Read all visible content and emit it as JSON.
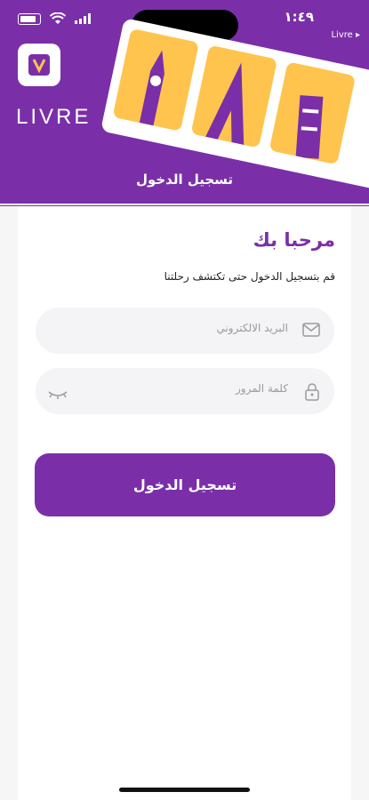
{
  "status_bar": {
    "time": "١:٤٩",
    "back_app": "Livre ▸"
  },
  "brand": {
    "name": "LIVRE"
  },
  "header": {
    "title": "تسجيل الدخول"
  },
  "form": {
    "welcome": "مرحبا بك",
    "subtitle": "قم بتسجيل الدخول حتى تكتشف رحلتنا",
    "email_placeholder": "البريد الالكتروني",
    "password_placeholder": "كلمة المرور",
    "submit_label": "تسجيل الدخول"
  },
  "colors": {
    "primary": "#7a2fa8",
    "accent": "#ffc44d",
    "field_bg": "#f4f4f6"
  },
  "icons": [
    "signal-icon",
    "wifi-icon",
    "battery-icon",
    "app-logo-icon",
    "mail-icon",
    "lock-icon",
    "eye-closed-icon"
  ]
}
